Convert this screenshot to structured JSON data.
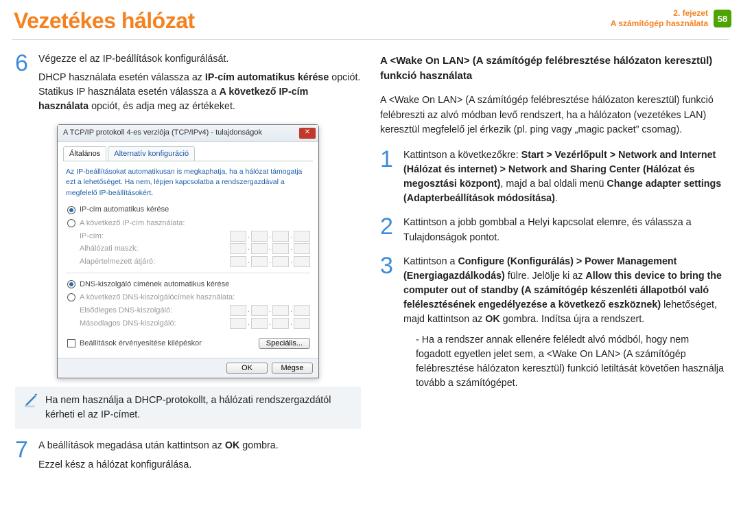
{
  "header": {
    "title": "Vezetékes hálózat",
    "chapter_line1": "2. fejezet",
    "chapter_line2": "A számítógép használata",
    "page_number": "58"
  },
  "left": {
    "step6": {
      "num": "6",
      "line1": "Végezze el az IP-beállítások konfigurálását.",
      "line2a": "DHCP használata esetén válassza az ",
      "line2b_bold": "IP-cím automatikus kérése",
      "line2c": " opciót. Statikus IP használata esetén válassza a ",
      "line2d_bold": "A következő IP-cím használata",
      "line2e": " opciót, és adja meg az értékeket."
    },
    "dialog": {
      "title": "A TCP/IP protokoll 4-es verziója (TCP/IPv4) - tulajdonságok",
      "tab1": "Általános",
      "tab2": "Alternatív konfiguráció",
      "info": "Az IP-beállításokat automatikusan is megkaphatja, ha a hálózat támogatja ezt a lehetőséget. Ha nem, lépjen kapcsolatba a rendszergazdával a megfelelő IP-beállításokért.",
      "radio_auto_ip": "IP-cím automatikus kérése",
      "radio_manual_ip": "A következő IP-cím használata:",
      "field_ip": "IP-cím:",
      "field_mask": "Alhálózati maszk:",
      "field_gw": "Alapértelmezett átjáró:",
      "radio_auto_dns": "DNS-kiszolgáló címének automatikus kérése",
      "radio_manual_dns": "A következő DNS-kiszolgálócímek használata:",
      "field_dns1": "Elsődleges DNS-kiszolgáló:",
      "field_dns2": "Másodlagos DNS-kiszolgáló:",
      "chk_validate": "Beállítások érvényesítése kilépéskor",
      "btn_advanced": "Speciális...",
      "btn_ok": "OK",
      "btn_cancel": "Mégse"
    },
    "note": "Ha nem használja a DHCP-protokollt, a hálózati rendszergazdától kérheti el az IP-címet.",
    "step7": {
      "num": "7",
      "text_a": "A beállítások megadása után kattintson az ",
      "text_b_bold": "OK",
      "text_c": " gombra.",
      "line2": "Ezzel kész a hálózat konfigurálása."
    }
  },
  "right": {
    "title": "A <Wake On LAN> (A számítógép felébresztése hálózaton keresztül) funkció használata",
    "intro": "A <Wake On LAN> (A számítógép felébresztése hálózaton keresztül) funkció felébreszti az alvó módban levő rendszert, ha a hálózaton (vezetékes LAN) keresztül megfelelő jel érkezik (pl. ping vagy „magic packet” csomag).",
    "step1": {
      "num": "1",
      "a": "Kattintson a következőkre: ",
      "b_bold": "Start > Vezérlőpult > Network and Internet (Hálózat és internet) > Network and Sharing Center (Hálózat és megosztási központ)",
      "c": ", majd a bal oldali menü ",
      "d_bold": "Change adapter settings (Adapterbeállítások módosítása)",
      "e": "."
    },
    "step2": {
      "num": "2",
      "text": "Kattintson a jobb gombbal a Helyi kapcsolat elemre, és válassza a Tulajdonságok pontot."
    },
    "step3": {
      "num": "3",
      "a": "Kattintson a ",
      "b_bold": "Configure (Konfigurálás) > Power Management (Energiagazdálkodás)",
      "c": " fülre. Jelölje ki az ",
      "d_bold": "Allow this device to bring the computer out of standby (A számítógép készenléti állapotból való felélesztésének engedélyezése a következő eszköznek)",
      "e": " lehetőséget, majd kattintson az ",
      "f_bold": "OK",
      "g": " gombra. Indítsa újra a rendszert.",
      "sub": "- Ha a rendszer annak ellenére feléledt alvó módból, hogy nem fogadott egyetlen jelet sem, a <Wake On LAN> (A számítógép felébresztése hálózaton keresztül) funkció letiltását követően használja tovább a számítógépet."
    }
  }
}
